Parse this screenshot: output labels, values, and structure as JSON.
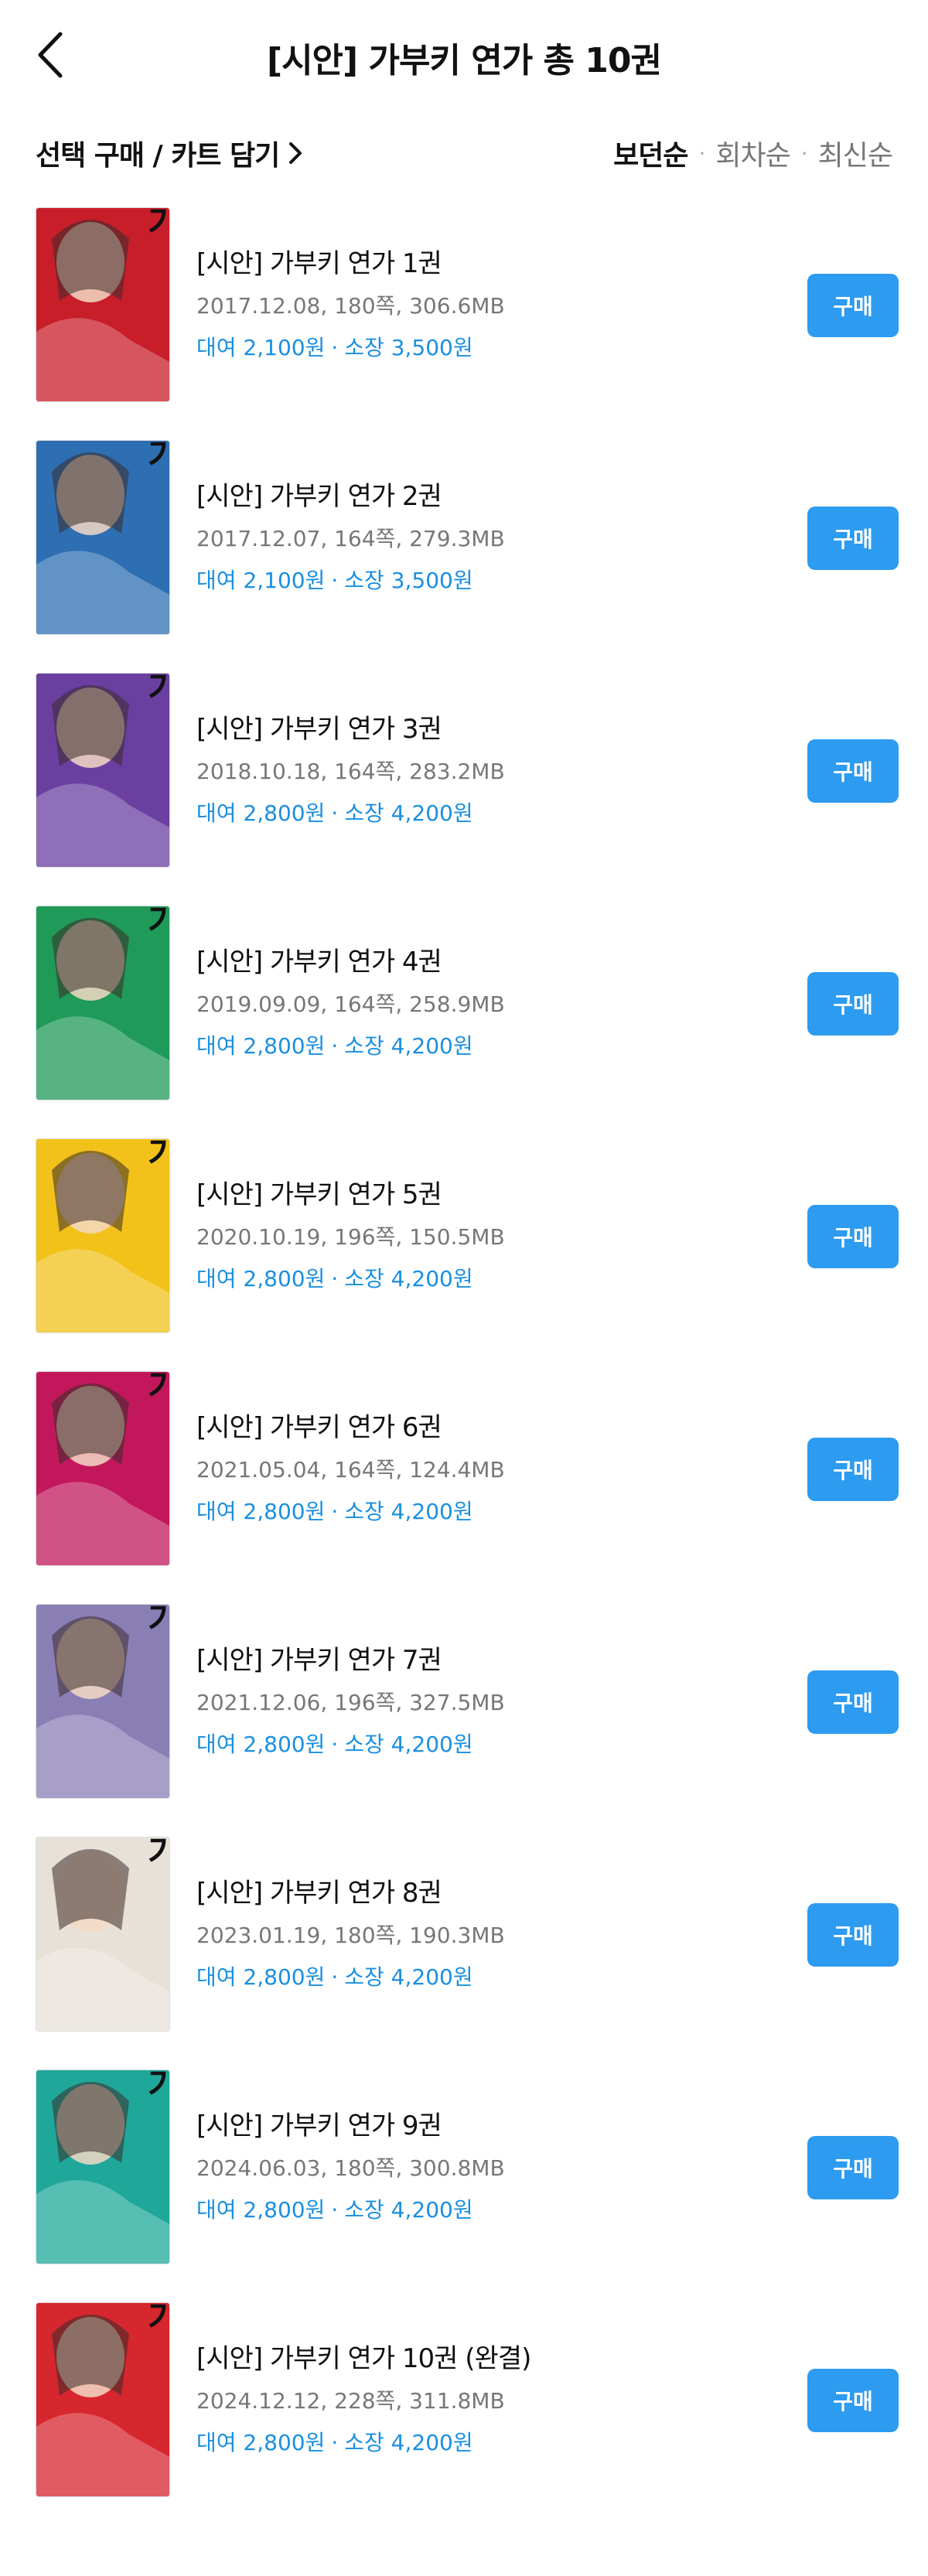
{
  "header": {
    "title": "[시안] 가부키 연가 총 10권",
    "back_icon": "chevron-left-icon"
  },
  "toolbar": {
    "select_buy_label": "선택 구매 / 카트 담기",
    "sort_options": [
      "보던순",
      "회차순",
      "최신순"
    ],
    "sort_active": "보던순"
  },
  "colors": {
    "accent": "#2d9bf0",
    "price_text": "#1a8fe0"
  },
  "cover_title": "가부키 연가",
  "volumes": [
    {
      "title": "[시안] 가부키 연가 1권",
      "meta": "2017.12.08, 180쪽, 306.6MB",
      "rent": "대여 2,100원",
      "own": "소장 3,500원",
      "buy": "구매",
      "cover_color": "#c81e2a"
    },
    {
      "title": "[시안] 가부키 연가 2권",
      "meta": "2017.12.07, 164쪽, 279.3MB",
      "rent": "대여 2,100원",
      "own": "소장 3,500원",
      "buy": "구매",
      "cover_color": "#2e6fb3"
    },
    {
      "title": "[시안] 가부키 연가 3권",
      "meta": "2018.10.18, 164쪽, 283.2MB",
      "rent": "대여 2,800원",
      "own": "소장 4,200원",
      "buy": "구매",
      "cover_color": "#6a3fa0"
    },
    {
      "title": "[시안] 가부키 연가 4권",
      "meta": "2019.09.09, 164쪽, 258.9MB",
      "rent": "대여 2,800원",
      "own": "소장 4,200원",
      "buy": "구매",
      "cover_color": "#1f9a58"
    },
    {
      "title": "[시안] 가부키 연가 5권",
      "meta": "2020.10.19, 196쪽, 150.5MB",
      "rent": "대여 2,800원",
      "own": "소장 4,200원",
      "buy": "구매",
      "cover_color": "#f2c21a"
    },
    {
      "title": "[시안] 가부키 연가 6권",
      "meta": "2021.05.04, 164쪽, 124.4MB",
      "rent": "대여 2,800원",
      "own": "소장 4,200원",
      "buy": "구매",
      "cover_color": "#c2185b"
    },
    {
      "title": "[시안] 가부키 연가 7권",
      "meta": "2021.12.06, 196쪽, 327.5MB",
      "rent": "대여 2,800원",
      "own": "소장 4,200원",
      "buy": "구매",
      "cover_color": "#8a7fb5"
    },
    {
      "title": "[시안] 가부키 연가 8권",
      "meta": "2023.01.19, 180쪽, 190.3MB",
      "rent": "대여 2,800원",
      "own": "소장 4,200원",
      "buy": "구매",
      "cover_color": "#e7e1d8"
    },
    {
      "title": "[시안] 가부키 연가 9권",
      "meta": "2024.06.03, 180쪽, 300.8MB",
      "rent": "대여 2,800원",
      "own": "소장 4,200원",
      "buy": "구매",
      "cover_color": "#1fa89a"
    },
    {
      "title": "[시안] 가부키 연가 10권 (완결)",
      "meta": "2024.12.12, 228쪽, 311.8MB",
      "rent": "대여 2,800원",
      "own": "소장 4,200원",
      "buy": "구매",
      "cover_color": "#d6262e"
    }
  ]
}
